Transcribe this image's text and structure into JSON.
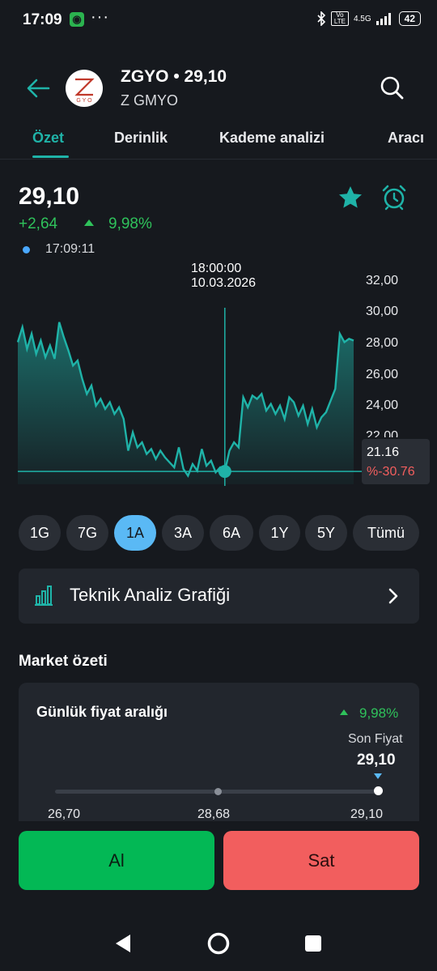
{
  "status_bar": {
    "time": "17:09",
    "app_badge": "◉",
    "more": "···",
    "network": "4.5G",
    "volte": "Vo LTE",
    "battery": "42"
  },
  "header": {
    "title": "ZGYO • 29,10",
    "subtitle": "Z GMYO"
  },
  "tabs": [
    {
      "label": "Özet",
      "active": true
    },
    {
      "label": "Derinlik"
    },
    {
      "label": "Kademe analizi"
    },
    {
      "label": "Aracı"
    }
  ],
  "quote": {
    "price": "29,10",
    "change": "+2,64",
    "change_pct": "9,98%",
    "time": "17:09:11"
  },
  "chart_data": {
    "type": "area",
    "crosshair_time": "18:00:00",
    "crosshair_date": "10.03.2026",
    "y_ticks": [
      "32,00",
      "30,00",
      "28,00",
      "26,00",
      "24,00",
      "22,00"
    ],
    "ylim": [
      20.0,
      33.0
    ],
    "crosshair_value": "21.16",
    "crosshair_change": "%-30.76",
    "series_color": "#1fb3a8",
    "values": [
      28.9,
      29.8,
      28.5,
      29.4,
      28.2,
      29.0,
      28.0,
      28.7,
      27.9,
      30.1,
      29.2,
      28.4,
      27.5,
      27.8,
      26.7,
      25.8,
      26.3,
      25.1,
      25.5,
      24.9,
      25.3,
      24.6,
      25.0,
      24.3,
      22.4,
      23.5,
      22.6,
      22.9,
      22.2,
      22.5,
      21.9,
      22.4,
      22.0,
      21.7,
      21.4,
      22.6,
      21.3,
      20.9,
      21.6,
      21.2,
      22.5,
      21.5,
      21.8,
      21.1,
      21.4,
      21.16,
      22.4,
      22.9,
      22.6,
      25.6,
      25.0,
      25.7,
      25.5,
      25.8,
      24.8,
      25.2,
      24.6,
      25.1,
      24.3,
      25.6,
      25.3,
      24.5,
      25.1,
      24.0,
      24.9,
      23.8,
      24.4,
      24.7,
      25.4,
      26.1,
      29.4,
      28.9,
      29.1,
      29.0
    ]
  },
  "periods": [
    {
      "label": "1G"
    },
    {
      "label": "7G"
    },
    {
      "label": "1A",
      "active": true
    },
    {
      "label": "3A"
    },
    {
      "label": "6A"
    },
    {
      "label": "1Y"
    },
    {
      "label": "5Y"
    },
    {
      "label": "Tümü"
    }
  ],
  "technical_analysis": {
    "label": "Teknik Analiz Grafiği"
  },
  "market_summary": {
    "title": "Market özeti",
    "daily_range_title": "Günlük fiyat aralığı",
    "daily_change_pct": "9,98%",
    "last_price_label": "Son Fiyat",
    "last_price": "29,10",
    "low": "26,70",
    "mid": "28,68",
    "high": "29,10",
    "last_position": 1.0
  },
  "actions": {
    "buy": "Al",
    "sell": "Sat"
  },
  "colors": {
    "accent": "#1fb3a8",
    "up": "#2fc25b",
    "down": "#f25e5e",
    "buy": "#03b855",
    "sell": "#f25e5e",
    "active_period": "#5ab9f5"
  }
}
